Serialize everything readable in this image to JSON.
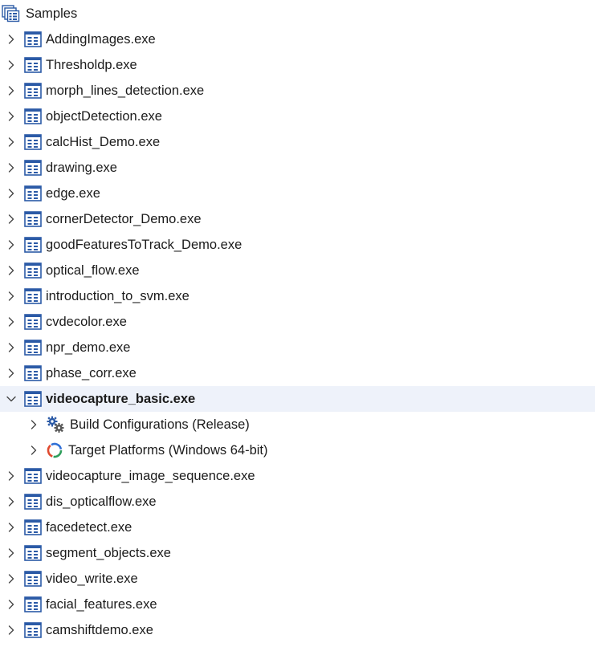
{
  "colors": {
    "selected_row_bg": "#eef2fa",
    "project_icon_blue": "#2b5aa6",
    "chevron": "#444444",
    "text": "#1b1b1b"
  },
  "tree": {
    "root": {
      "label": "Samples",
      "icon": "solution-icon"
    },
    "items": [
      {
        "label": "AddingImages.exe",
        "icon": "project-icon",
        "expanded": false
      },
      {
        "label": "Thresholdp.exe",
        "icon": "project-icon",
        "expanded": false
      },
      {
        "label": "morph_lines_detection.exe",
        "icon": "project-icon",
        "expanded": false
      },
      {
        "label": "objectDetection.exe",
        "icon": "project-icon",
        "expanded": false
      },
      {
        "label": "calcHist_Demo.exe",
        "icon": "project-icon",
        "expanded": false
      },
      {
        "label": "drawing.exe",
        "icon": "project-icon",
        "expanded": false
      },
      {
        "label": "edge.exe",
        "icon": "project-icon",
        "expanded": false
      },
      {
        "label": "cornerDetector_Demo.exe",
        "icon": "project-icon",
        "expanded": false
      },
      {
        "label": "goodFeaturesToTrack_Demo.exe",
        "icon": "project-icon",
        "expanded": false
      },
      {
        "label": "optical_flow.exe",
        "icon": "project-icon",
        "expanded": false
      },
      {
        "label": "introduction_to_svm.exe",
        "icon": "project-icon",
        "expanded": false
      },
      {
        "label": "cvdecolor.exe",
        "icon": "project-icon",
        "expanded": false
      },
      {
        "label": "npr_demo.exe",
        "icon": "project-icon",
        "expanded": false
      },
      {
        "label": "phase_corr.exe",
        "icon": "project-icon",
        "expanded": false
      },
      {
        "label": "videocapture_basic.exe",
        "icon": "project-icon",
        "expanded": true,
        "selected": true,
        "children": [
          {
            "label": "Build Configurations (Release)",
            "icon": "gears-icon",
            "expanded": false
          },
          {
            "label": "Target Platforms (Windows 64-bit)",
            "icon": "target-platforms-icon",
            "expanded": false
          }
        ]
      },
      {
        "label": "videocapture_image_sequence.exe",
        "icon": "project-icon",
        "expanded": false
      },
      {
        "label": "dis_opticalflow.exe",
        "icon": "project-icon",
        "expanded": false
      },
      {
        "label": "facedetect.exe",
        "icon": "project-icon",
        "expanded": false
      },
      {
        "label": "segment_objects.exe",
        "icon": "project-icon",
        "expanded": false
      },
      {
        "label": "video_write.exe",
        "icon": "project-icon",
        "expanded": false
      },
      {
        "label": "facial_features.exe",
        "icon": "project-icon",
        "expanded": false
      },
      {
        "label": "camshiftdemo.exe",
        "icon": "project-icon",
        "expanded": false
      }
    ]
  }
}
